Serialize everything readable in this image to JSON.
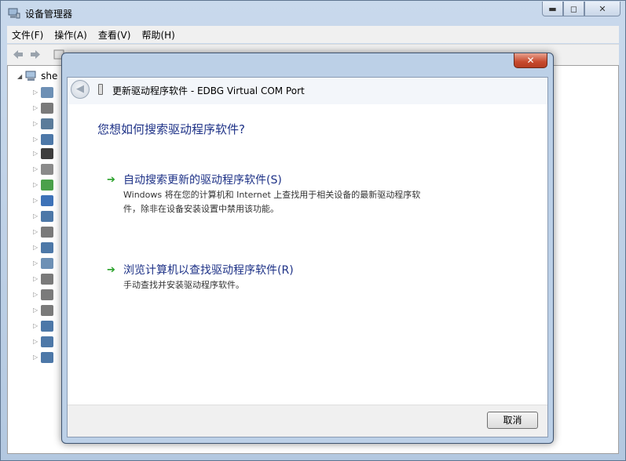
{
  "window": {
    "title": "设备管理器",
    "controls": {
      "minimize": "▬",
      "maximize": "◻",
      "close": "✕"
    }
  },
  "menu": [
    "文件(F)",
    "操作(A)",
    "查看(V)",
    "帮助(H)"
  ],
  "tree": {
    "root_label": "she",
    "device_icon_colors": [
      "#6d90b5",
      "#7a7a7a",
      "#5b7c9a",
      "#4d78a8",
      "#3c3c3c",
      "#8a8a8a",
      "#4aa04a",
      "#3d72b8",
      "#4d78a8",
      "#7a7a7a",
      "#4d78a8",
      "#6d90b5",
      "#7a7a7a",
      "#7a7a7a",
      "#7a7a7a",
      "#4d78a8",
      "#4d78a8",
      "#4d78a8"
    ]
  },
  "dialog": {
    "close_label": "✕",
    "title": "更新驱动程序软件 - EDBG Virtual COM Port",
    "question": "您想如何搜索驱动程序软件?",
    "options": [
      {
        "title": "自动搜索更新的驱动程序软件(S)",
        "desc_line1": "Windows 将在您的计算机和 Internet 上查找用于相关设备的最新驱动程序软",
        "desc_line2": "件，除非在设备安装设置中禁用该功能。"
      },
      {
        "title": "浏览计算机以查找驱动程序软件(R)",
        "desc_line1": "手动查找并安装驱动程序软件。"
      }
    ],
    "cancel_label": "取消",
    "accent_color": "#1e3287",
    "arrow_color": "#2aa12a"
  }
}
